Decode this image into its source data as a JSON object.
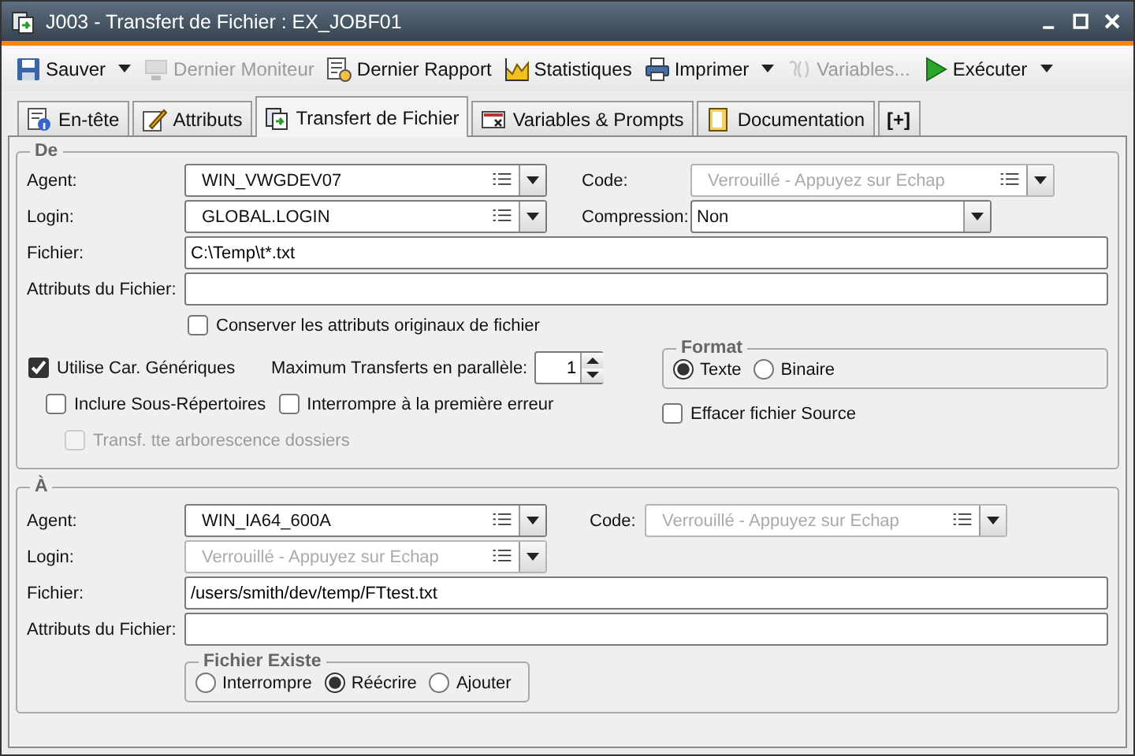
{
  "window": {
    "title": "J003 - Transfert de Fichier : EX_JOBF01"
  },
  "toolbar": [
    {
      "label": "Sauver",
      "disabled": false,
      "dropdown": true
    },
    {
      "label": "Dernier Moniteur",
      "disabled": true,
      "dropdown": false
    },
    {
      "label": "Dernier Rapport",
      "disabled": false,
      "dropdown": false
    },
    {
      "label": "Statistiques",
      "disabled": false,
      "dropdown": false
    },
    {
      "label": "Imprimer",
      "disabled": false,
      "dropdown": true
    },
    {
      "label": "Variables...",
      "disabled": true,
      "dropdown": false
    },
    {
      "label": "Exécuter",
      "disabled": false,
      "dropdown": true
    }
  ],
  "tabs": [
    {
      "label": "En-tête",
      "selected": false
    },
    {
      "label": "Attributs",
      "selected": false
    },
    {
      "label": "Transfert de Fichier",
      "selected": true
    },
    {
      "label": "Variables & Prompts",
      "selected": false
    },
    {
      "label": "Documentation",
      "selected": false
    },
    {
      "label": "[+]",
      "selected": false
    }
  ],
  "source": {
    "title": "De",
    "agent": {
      "label": "Agent:",
      "value": "WIN_VWGDEV07"
    },
    "code": {
      "label": "Code:",
      "placeholder": "Verrouillé - Appuyez sur Echap"
    },
    "login": {
      "label": "Login:",
      "value": "GLOBAL.LOGIN"
    },
    "compression": {
      "label": "Compression:",
      "value": "Non"
    },
    "file": {
      "label": "Fichier:",
      "value": "C:\\Temp\\t*.txt"
    },
    "attributes": {
      "label": "Attributs du Fichier:"
    },
    "keep_attributes": {
      "label": "Conserver les attributs originaux de fichier",
      "checked": false,
      "disabled": false
    },
    "wildcards": {
      "label": "Utilise Car. Génériques",
      "checked": true,
      "disabled": false
    },
    "max_transfers": {
      "label": "Maximum Transferts en parallèle:",
      "value": "1"
    },
    "include_subdirs": {
      "label": "Inclure Sous-Répertoires",
      "checked": false,
      "disabled": false
    },
    "stop_on_error": {
      "label": "Interrompre à la première erreur",
      "checked": false,
      "disabled": false
    },
    "transfer_tree": {
      "label": "Transf. tte arborescence dossiers",
      "checked": false,
      "disabled": true
    },
    "format": {
      "title": "Format",
      "options": [
        {
          "label": "Texte",
          "selected": true
        },
        {
          "label": "Binaire",
          "selected": false
        }
      ]
    },
    "delete_source": {
      "label": "Effacer fichier Source",
      "checked": false,
      "disabled": false
    }
  },
  "destination": {
    "title": "À",
    "agent": {
      "label": "Agent:",
      "value": "WIN_IA64_600A"
    },
    "code": {
      "label": "Code:",
      "placeholder": "Verrouillé - Appuyez sur Echap"
    },
    "login": {
      "label": "Login:",
      "placeholder": "Verrouillé - Appuyez sur Echap"
    },
    "file": {
      "label": "Fichier:",
      "value": "/users/smith/dev/temp/FTtest.txt"
    },
    "attributes": {
      "label": "Attributs du Fichier:"
    },
    "file_exists": {
      "title": "Fichier Existe",
      "options": [
        {
          "label": "Interrompre",
          "selected": false
        },
        {
          "label": "Réécrire",
          "selected": true
        },
        {
          "label": "Ajouter",
          "selected": false
        }
      ]
    }
  }
}
